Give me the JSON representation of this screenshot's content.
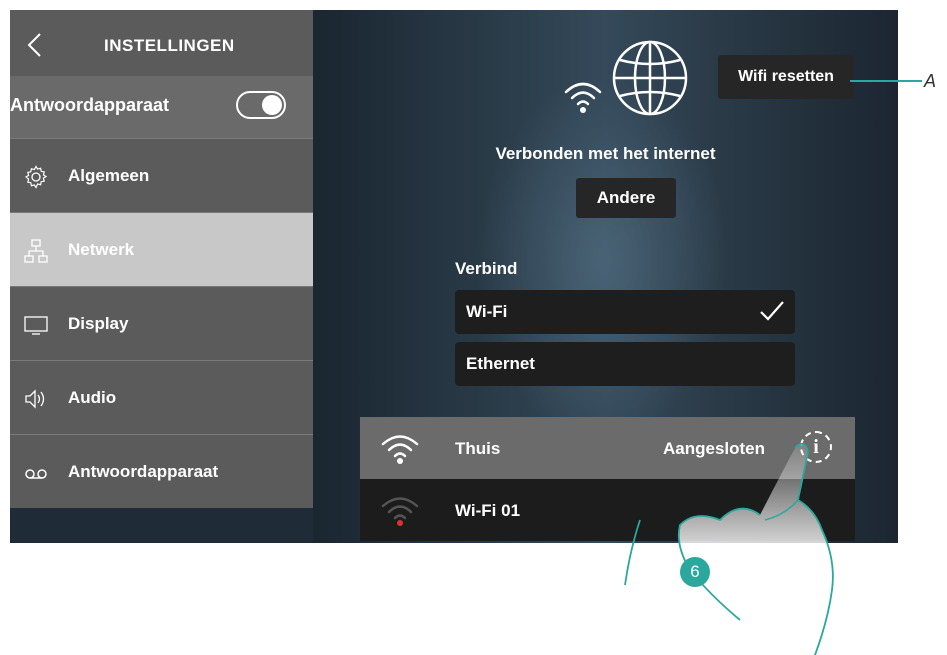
{
  "sidebar": {
    "title": "INSTELLINGEN",
    "answering_toggle_label": "Antwoordapparaat",
    "answering_toggle_on": true,
    "items": [
      {
        "label": "Algemeen",
        "icon": "gear-icon"
      },
      {
        "label": "Netwerk",
        "icon": "network-icon",
        "active": true
      },
      {
        "label": "Display",
        "icon": "display-icon"
      },
      {
        "label": "Audio",
        "icon": "speaker-icon"
      },
      {
        "label": "Antwoordapparaat",
        "icon": "voicemail-icon"
      }
    ]
  },
  "main": {
    "reset_button": "Wifi resetten",
    "connected_text": "Verbonden met het internet",
    "other_button": "Andere",
    "connect_label": "Verbind",
    "options": [
      {
        "label": "Wi-Fi",
        "selected": true
      },
      {
        "label": "Ethernet",
        "selected": false
      }
    ],
    "networks": [
      {
        "name": "Thuis",
        "status": "Aangesloten",
        "info": "i"
      },
      {
        "name": "Wi-Fi 01",
        "status": ""
      }
    ]
  },
  "annotations": {
    "callout": "A",
    "step": "6"
  },
  "colors": {
    "accent": "#2aa89e",
    "sidebar_bg": "#5b5b5b",
    "sidebar_active": "#c8c8c8",
    "button_bg": "#262626"
  }
}
